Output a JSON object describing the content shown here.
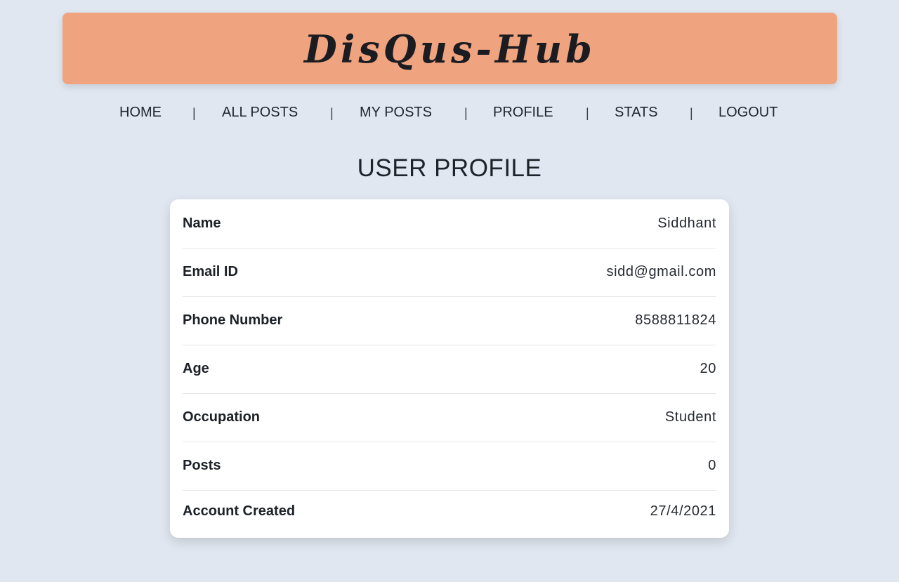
{
  "app": {
    "title": "DisQus-Hub"
  },
  "nav": {
    "items": [
      {
        "label": "HOME"
      },
      {
        "label": "ALL POSTS"
      },
      {
        "label": "MY POSTS"
      },
      {
        "label": "PROFILE"
      },
      {
        "label": "STATS"
      },
      {
        "label": "LOGOUT"
      }
    ],
    "separator": "|"
  },
  "profile": {
    "heading": "USER PROFILE",
    "rows": [
      {
        "label": "Name",
        "value": "Siddhant"
      },
      {
        "label": "Email ID",
        "value": "sidd@gmail.com"
      },
      {
        "label": "Phone Number",
        "value": "8588811824"
      },
      {
        "label": "Age",
        "value": "20"
      },
      {
        "label": "Occupation",
        "value": "Student"
      },
      {
        "label": "Posts",
        "value": "0"
      },
      {
        "label": "Account Created",
        "value": "27/4/2021"
      }
    ]
  },
  "colors": {
    "background": "#e1e7f0",
    "banner": "#efa47f",
    "card": "#ffffff"
  }
}
